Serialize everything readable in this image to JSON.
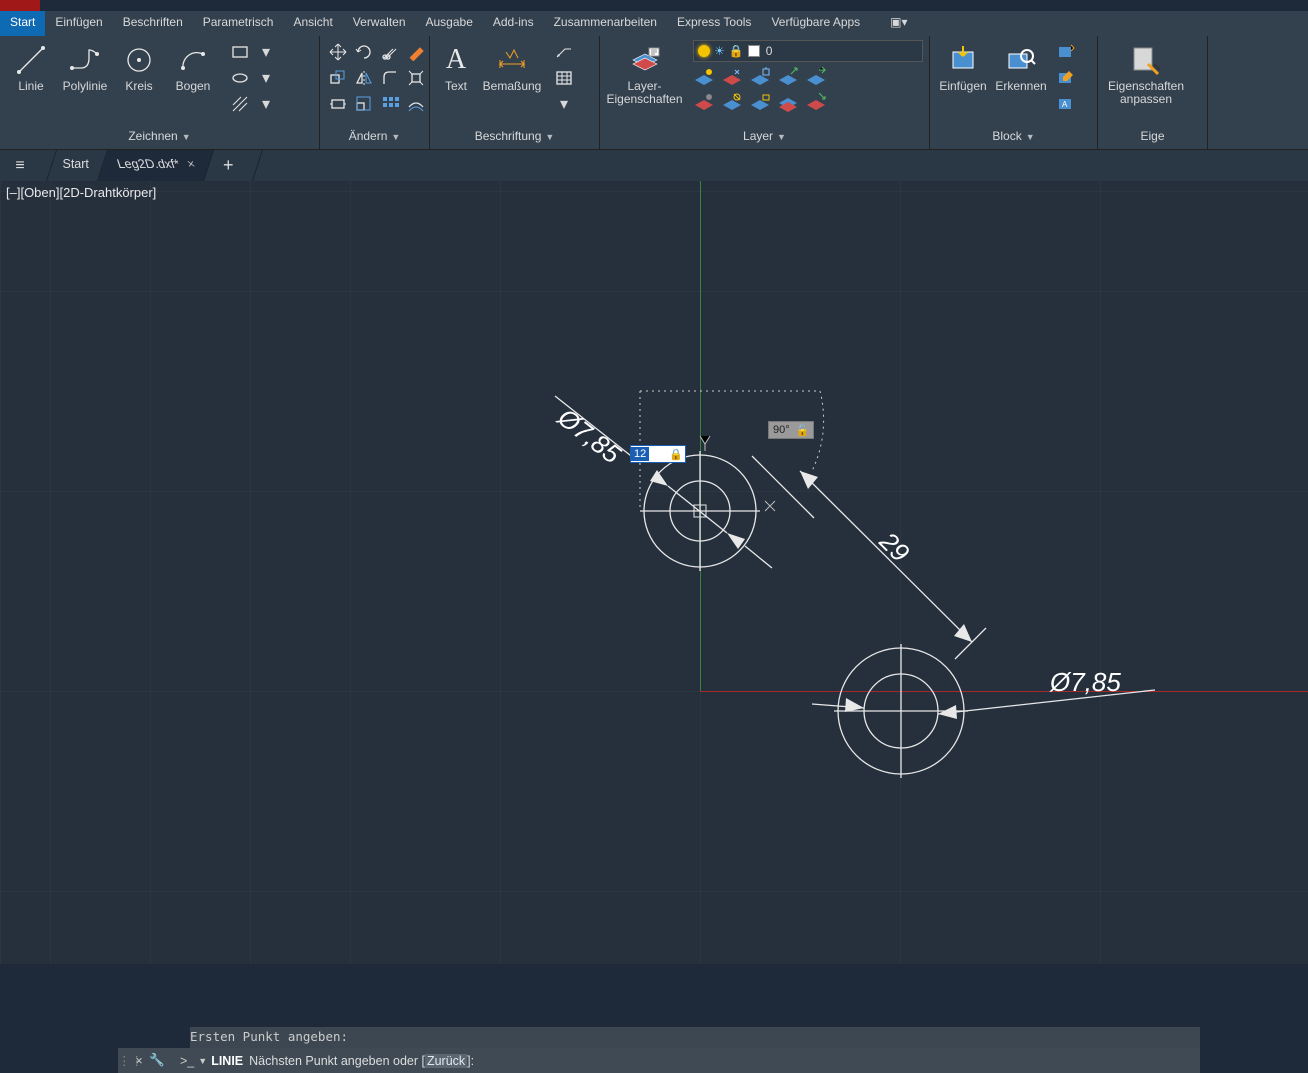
{
  "menu": {
    "tabs": [
      "Start",
      "Einfügen",
      "Beschriften",
      "Parametrisch",
      "Ansicht",
      "Verwalten",
      "Ausgabe",
      "Add-ins",
      "Zusammenarbeiten",
      "Express Tools",
      "Verfügbare Apps"
    ],
    "active": 0
  },
  "ribbon": {
    "draw": {
      "title": "Zeichnen",
      "line": "Linie",
      "polyline": "Polylinie",
      "circle": "Kreis",
      "arc": "Bogen"
    },
    "modify": {
      "title": "Ändern"
    },
    "annotate": {
      "title": "Beschriftung",
      "text": "Text",
      "dim": "Bemaßung"
    },
    "layer": {
      "title": "Layer",
      "big": "Layer-\nEigenschaften",
      "current": "0"
    },
    "block": {
      "title": "Block",
      "insert": "Einfügen",
      "detect": "Erkennen"
    },
    "props": {
      "title": "Eige",
      "match": "Eigenschaften\nanpassen"
    }
  },
  "file_tabs": {
    "start": "Start",
    "active": "Leg2D.dxf*"
  },
  "viewport_label": "[–][Oben][2D-Drahtkörper]",
  "drawing": {
    "diam1": "Ø7,85",
    "diam2": "Ø7,85",
    "dist": "29",
    "input_distance": "12",
    "input_angle": "90°"
  },
  "command": {
    "history": "Ersten Punkt angeben:",
    "name": "LINIE",
    "prompt_prefix": "Nächsten Punkt angeben oder [",
    "option": "Zurück",
    "prompt_suffix": "]:"
  }
}
